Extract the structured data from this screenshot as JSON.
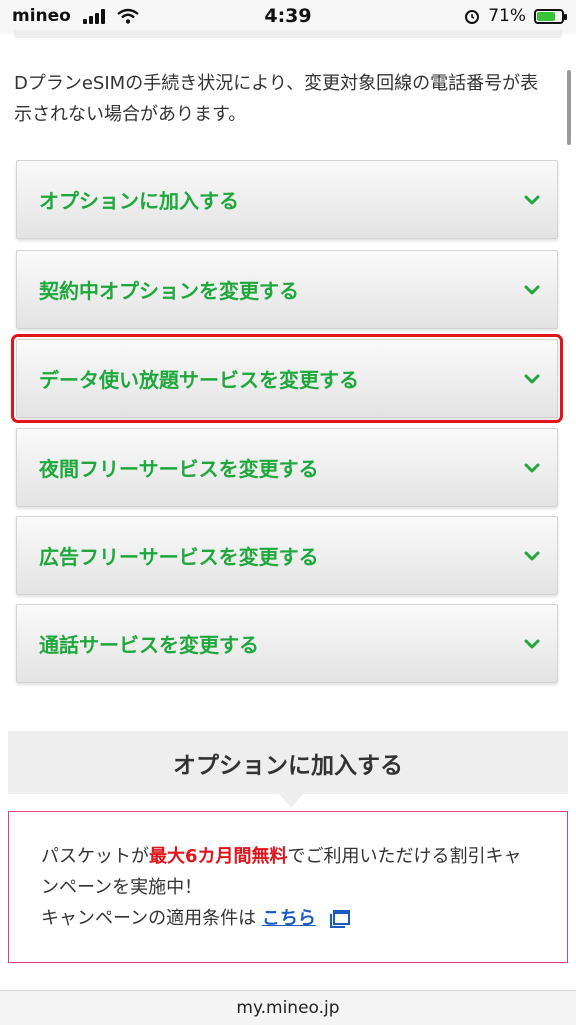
{
  "status_bar": {
    "carrier": "mineo",
    "time": "4:39",
    "battery": "71%",
    "battery_level": 0.71
  },
  "notice_text": "DプランeSIMの手続き状況により、変更対象回線の電話番号が表示されない場合があります。",
  "options": [
    {
      "label": "オプションに加入する"
    },
    {
      "label": "契約中オプションを変更する"
    },
    {
      "label": "データ使い放題サービスを変更する",
      "highlighted": true
    },
    {
      "label": "夜間フリーサービスを変更する"
    },
    {
      "label": "広告フリーサービスを変更する"
    },
    {
      "label": "通話サービスを変更する"
    }
  ],
  "section_title": "オプションに加入する",
  "campaign": {
    "text_before": "パスケットが",
    "text_highlight": "最大6カ月間無料",
    "text_after": "でご利用いただける割引キャンペーンを実施中！",
    "condition_text": "キャンペーンの適用条件は",
    "link_text": "こちら"
  },
  "url_bar": "my.mineo.jp",
  "colors": {
    "accent_green": "#1ea83c",
    "highlight_red": "#e0141b",
    "link_blue": "#1a5bc2",
    "campaign_border": "#e0417a"
  }
}
